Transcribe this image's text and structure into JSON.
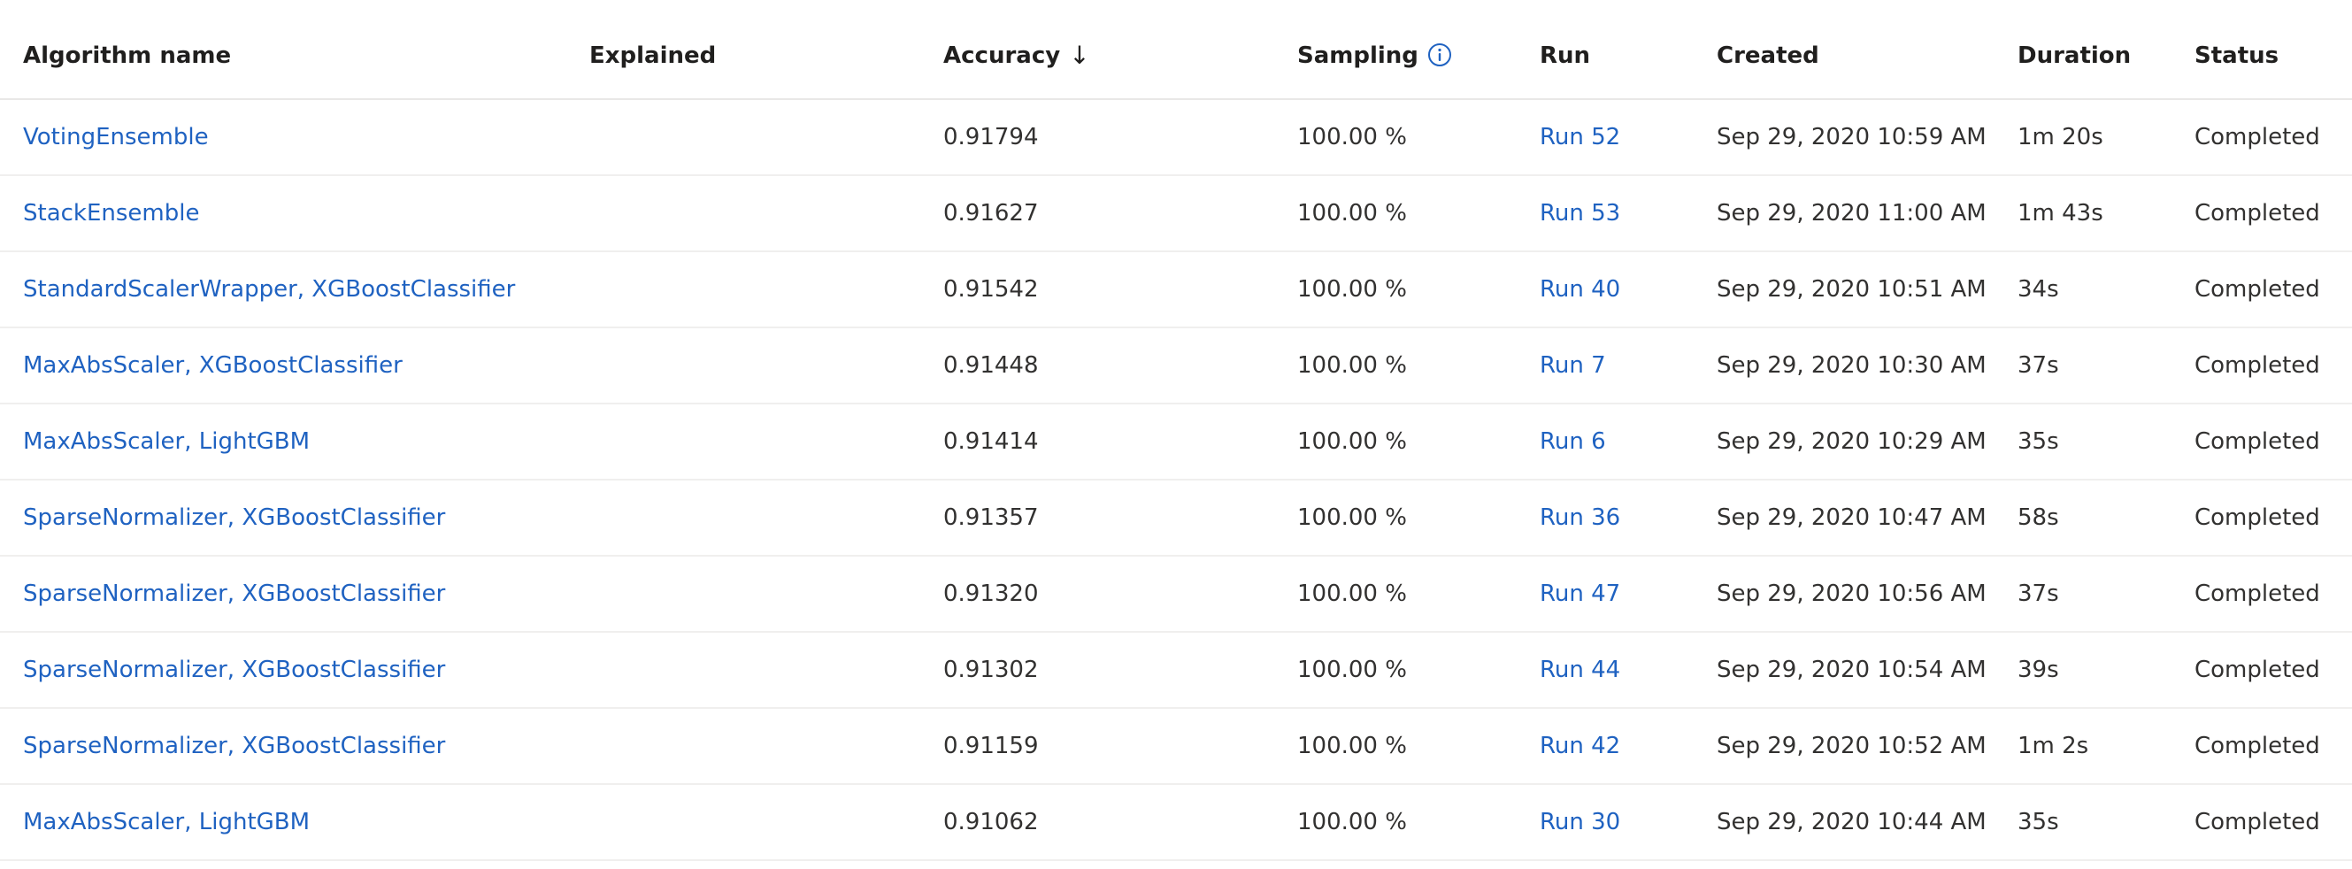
{
  "columns": {
    "algorithm": "Algorithm name",
    "explained": "Explained",
    "accuracy": "Accuracy",
    "sampling": "Sampling",
    "run": "Run",
    "created": "Created",
    "duration": "Duration",
    "status": "Status"
  },
  "sort": {
    "column": "accuracy",
    "direction": "descending",
    "icon": "arrow-down-icon"
  },
  "icons": {
    "sampling_info": "info-icon"
  },
  "colors": {
    "link": "#1f62c1",
    "text": "#323130",
    "divider": "#f0efee"
  },
  "rows": [
    {
      "algorithm": "VotingEnsemble",
      "explained": "",
      "accuracy": "0.91794",
      "sampling": "100.00 %",
      "run": "Run 52",
      "created": "Sep 29, 2020 10:59 AM",
      "duration": "1m 20s",
      "status": "Completed"
    },
    {
      "algorithm": "StackEnsemble",
      "explained": "",
      "accuracy": "0.91627",
      "sampling": "100.00 %",
      "run": "Run 53",
      "created": "Sep 29, 2020 11:00 AM",
      "duration": "1m 43s",
      "status": "Completed"
    },
    {
      "algorithm": "StandardScalerWrapper, XGBoostClassifier",
      "explained": "",
      "accuracy": "0.91542",
      "sampling": "100.00 %",
      "run": "Run 40",
      "created": "Sep 29, 2020 10:51 AM",
      "duration": "34s",
      "status": "Completed"
    },
    {
      "algorithm": "MaxAbsScaler, XGBoostClassifier",
      "explained": "",
      "accuracy": "0.91448",
      "sampling": "100.00 %",
      "run": "Run 7",
      "created": "Sep 29, 2020 10:30 AM",
      "duration": "37s",
      "status": "Completed"
    },
    {
      "algorithm": "MaxAbsScaler, LightGBM",
      "explained": "",
      "accuracy": "0.91414",
      "sampling": "100.00 %",
      "run": "Run 6",
      "created": "Sep 29, 2020 10:29 AM",
      "duration": "35s",
      "status": "Completed"
    },
    {
      "algorithm": "SparseNormalizer, XGBoostClassifier",
      "explained": "",
      "accuracy": "0.91357",
      "sampling": "100.00 %",
      "run": "Run 36",
      "created": "Sep 29, 2020 10:47 AM",
      "duration": "58s",
      "status": "Completed"
    },
    {
      "algorithm": "SparseNormalizer, XGBoostClassifier",
      "explained": "",
      "accuracy": "0.91320",
      "sampling": "100.00 %",
      "run": "Run 47",
      "created": "Sep 29, 2020 10:56 AM",
      "duration": "37s",
      "status": "Completed"
    },
    {
      "algorithm": "SparseNormalizer, XGBoostClassifier",
      "explained": "",
      "accuracy": "0.91302",
      "sampling": "100.00 %",
      "run": "Run 44",
      "created": "Sep 29, 2020 10:54 AM",
      "duration": "39s",
      "status": "Completed"
    },
    {
      "algorithm": "SparseNormalizer, XGBoostClassifier",
      "explained": "",
      "accuracy": "0.91159",
      "sampling": "100.00 %",
      "run": "Run 42",
      "created": "Sep 29, 2020 10:52 AM",
      "duration": "1m 2s",
      "status": "Completed"
    },
    {
      "algorithm": "MaxAbsScaler, LightGBM",
      "explained": "",
      "accuracy": "0.91062",
      "sampling": "100.00 %",
      "run": "Run 30",
      "created": "Sep 29, 2020 10:44 AM",
      "duration": "35s",
      "status": "Completed"
    }
  ]
}
